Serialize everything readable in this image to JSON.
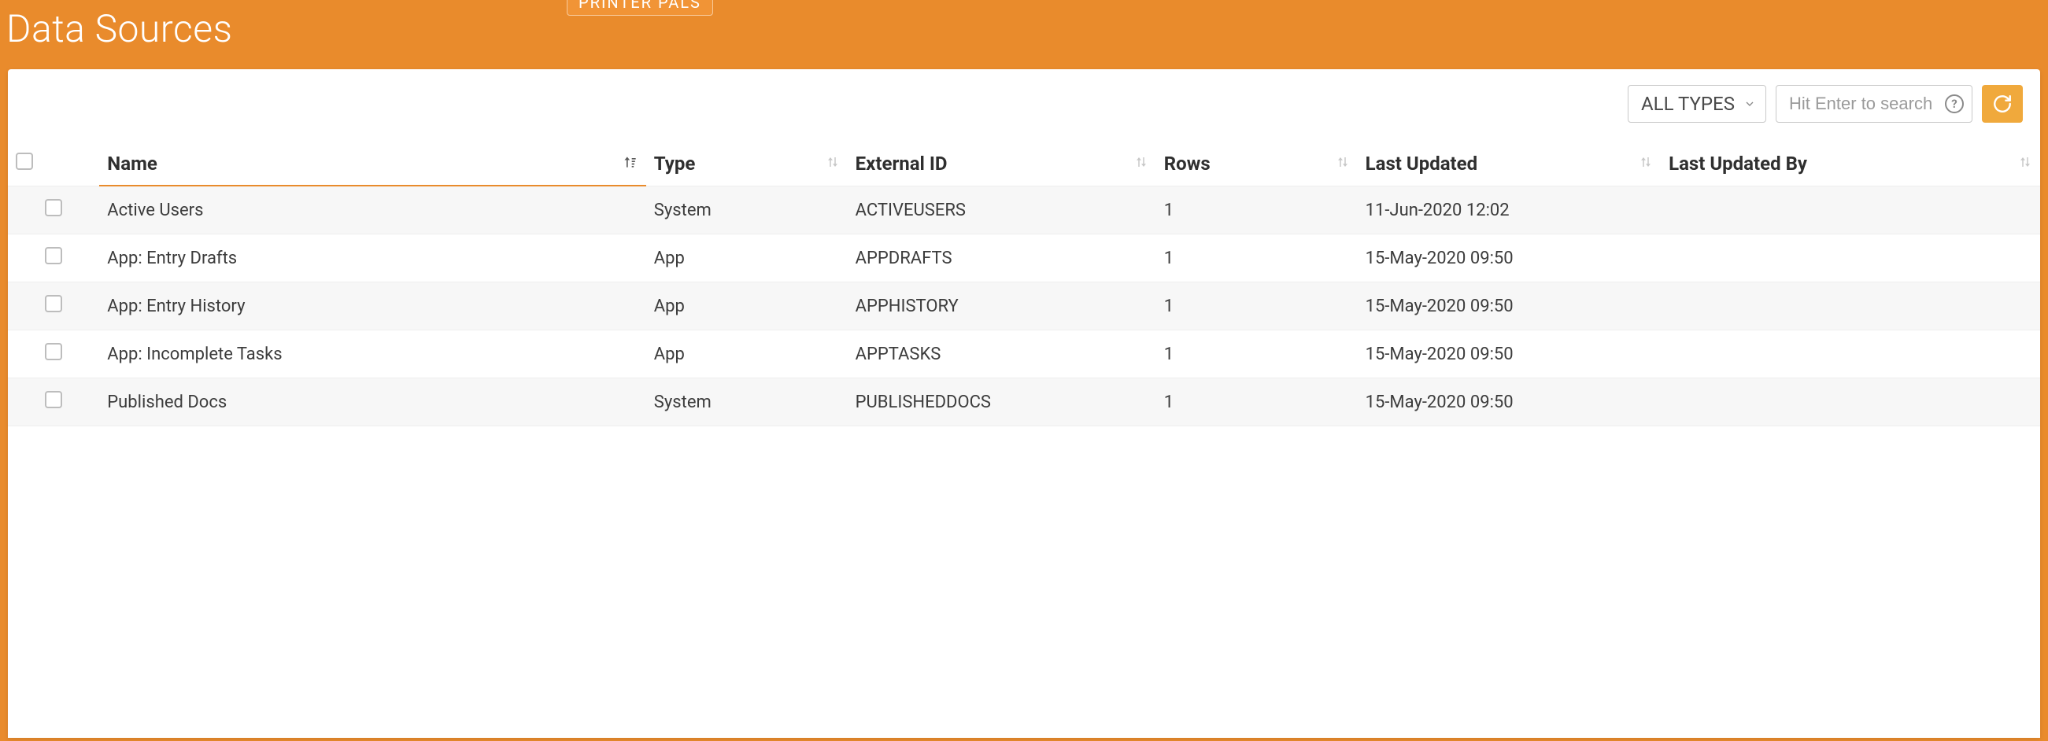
{
  "header": {
    "page_title": "Data Sources",
    "badge": "PRINTER PALS"
  },
  "toolbar": {
    "filter_label": "ALL TYPES",
    "search_placeholder": "Hit Enter to search"
  },
  "columns": {
    "name": "Name",
    "type": "Type",
    "external_id": "External ID",
    "rows": "Rows",
    "last_updated": "Last Updated",
    "last_updated_by": "Last Updated By"
  },
  "rows": [
    {
      "name": "Active Users",
      "type": "System",
      "external_id": "ACTIVEUSERS",
      "rows": "1",
      "last_updated": "11-Jun-2020 12:02",
      "last_updated_by": ""
    },
    {
      "name": "App: Entry Drafts",
      "type": "App",
      "external_id": "APPDRAFTS",
      "rows": "1",
      "last_updated": "15-May-2020 09:50",
      "last_updated_by": ""
    },
    {
      "name": "App: Entry History",
      "type": "App",
      "external_id": "APPHISTORY",
      "rows": "1",
      "last_updated": "15-May-2020 09:50",
      "last_updated_by": ""
    },
    {
      "name": "App: Incomplete Tasks",
      "type": "App",
      "external_id": "APPTASKS",
      "rows": "1",
      "last_updated": "15-May-2020 09:50",
      "last_updated_by": ""
    },
    {
      "name": "Published Docs",
      "type": "System",
      "external_id": "PUBLISHEDDOCS",
      "rows": "1",
      "last_updated": "15-May-2020 09:50",
      "last_updated_by": ""
    }
  ]
}
